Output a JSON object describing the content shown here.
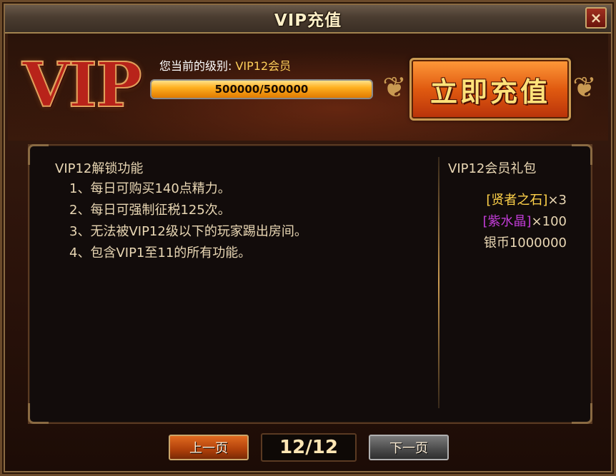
{
  "window": {
    "title": "VIP充值",
    "close_label": "×"
  },
  "header": {
    "logo_text": "VIP",
    "level_prefix": "您当前的级别: ",
    "level_value": "VIP12会员",
    "progress_text": "500000/500000",
    "progress_fraction": 1.0,
    "recharge_label": "立即充值",
    "ornament_glyph": "❦"
  },
  "unlock": {
    "title": "VIP12解锁功能",
    "items": [
      "1、每日可购买140点精力。",
      "2、每日可强制征税125次。",
      "3、无法被VIP12级以下的玩家踢出房间。",
      "4、包含VIP1至11的所有功能。"
    ]
  },
  "gift": {
    "title": "VIP12会员礼包",
    "items": [
      {
        "name": "[贤者之石]",
        "qty": "×3",
        "color": "#ffd24a"
      },
      {
        "name": "[紫水晶]",
        "qty": "×100",
        "color": "#c23cd8"
      },
      {
        "name": "银币1000000",
        "qty": "",
        "color": "#e9d7b4"
      }
    ]
  },
  "pager": {
    "prev_label": "上一页",
    "indicator": "12/12",
    "next_label": "下一页"
  },
  "colors": {
    "accent": "#ffcf5a",
    "panel_bg": "#120c0b",
    "text": "#e9d7b4"
  }
}
